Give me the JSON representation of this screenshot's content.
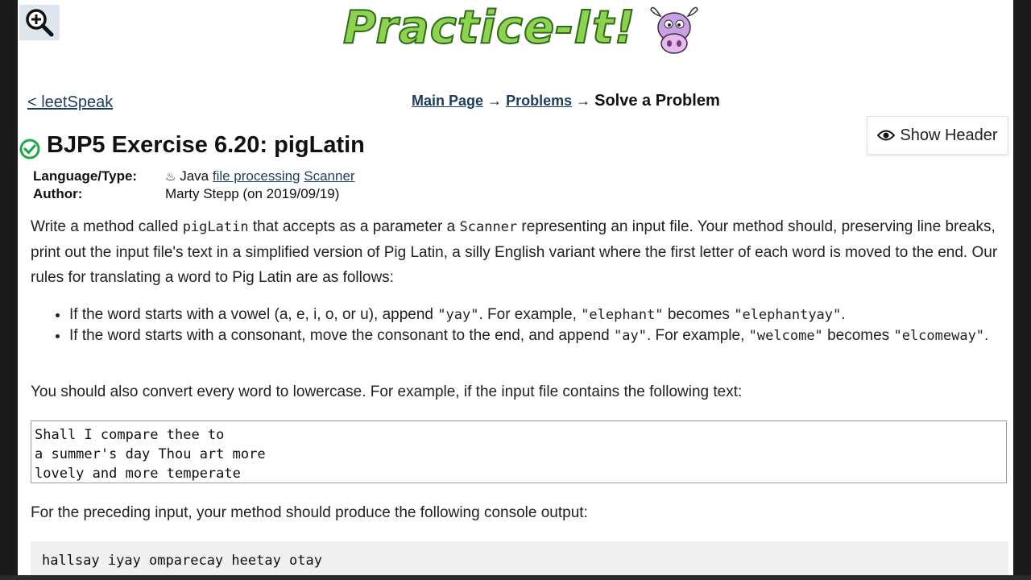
{
  "logo": {
    "text": "Practice-It!"
  },
  "nav": {
    "back_link": "< leetSpeak",
    "breadcrumb": [
      {
        "label": "Main Page",
        "link": true
      },
      {
        "label": "Problems",
        "link": true
      },
      {
        "label": "Solve a Problem",
        "link": false
      }
    ],
    "separator": "→"
  },
  "show_header": {
    "label": "Show Header"
  },
  "problem": {
    "title": "BJP5 Exercise 6.20: pigLatin",
    "solved": true,
    "language_label": "Language/Type:",
    "language": "Java",
    "tags": [
      "file processing",
      "Scanner"
    ],
    "author_label": "Author:",
    "author": "Marty Stepp (on 2019/09/19)"
  },
  "description": {
    "p1_a": "Write a method called ",
    "p1_code1": "pigLatin",
    "p1_b": " that accepts as a parameter a ",
    "p1_code2": "Scanner",
    "p1_c": " representing an input file. Your method should, preserving line breaks, print out the input file's text in a simplified version of Pig Latin, a silly English variant where the first letter of each word is moved to the end. Our rules for translating a word to Pig Latin are as follows:",
    "rule1": {
      "a": "If the word starts with a vowel (a, e, i, o, or u), append ",
      "c1": "\"yay\"",
      "b": ". For example, ",
      "c2": "\"elephant\"",
      "c": " becomes ",
      "c3": "\"elephantyay\"",
      "d": "."
    },
    "rule2": {
      "a": "If the word starts with a consonant, move the consonant to the end, and append ",
      "c1": "\"ay\"",
      "b": ". For example, ",
      "c2": "\"welcome\"",
      "c": " becomes ",
      "c3": "\"elcomeway\"",
      "d": "."
    },
    "p2": "You should also convert every word to lowercase. For example, if the input file contains the following text:",
    "input_text": "Shall I compare thee to\na summer's day Thou art more\nlovely and more temperate",
    "p3": "For the preceding input, your method should produce the following console output:",
    "output_text": "hallsay iyay omparecay heetay otay"
  },
  "colors": {
    "link": "#1d3c5e",
    "logo_green": "#8ed34f",
    "check_green": "#1fa84a",
    "cow_purple": "#c9a0e6"
  }
}
